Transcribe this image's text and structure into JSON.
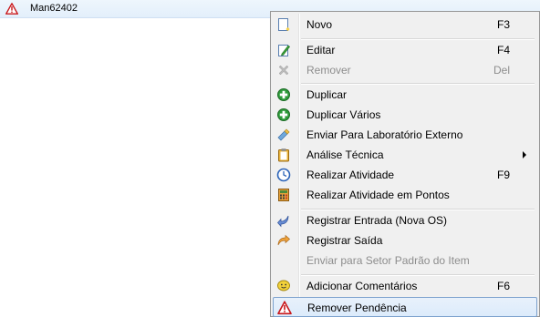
{
  "list": {
    "row_label": "Man62402"
  },
  "menu": {
    "items": {
      "novo": {
        "label": "Novo",
        "shortcut": "F3"
      },
      "editar": {
        "label": "Editar",
        "shortcut": "F4"
      },
      "remover": {
        "label": "Remover",
        "shortcut": "Del"
      },
      "duplicar": {
        "label": "Duplicar"
      },
      "duplicar_varios": {
        "label": "Duplicar Vários"
      },
      "enviar_lab": {
        "label": "Enviar Para Laboratório Externo"
      },
      "analise_tecnica": {
        "label": "Análise Técnica"
      },
      "realizar_atividade": {
        "label": "Realizar Atividade",
        "shortcut": "F9"
      },
      "realizar_pontos": {
        "label": "Realizar Atividade em Pontos"
      },
      "registrar_entrada": {
        "label": "Registrar Entrada (Nova OS)"
      },
      "registrar_saida": {
        "label": "Registrar Saída"
      },
      "enviar_setor": {
        "label": "Enviar para Setor Padrão do Item"
      },
      "adicionar_comentarios": {
        "label": "Adicionar Comentários",
        "shortcut": "F6"
      },
      "remover_pendencia": {
        "label": "Remover Pendência"
      }
    }
  },
  "icons": {
    "row": "warning-icon",
    "novo": "new-document-icon",
    "editar": "edit-pencil-icon",
    "remover": "delete-x-icon",
    "duplicar": "green-plus-icon",
    "duplicar_varios": "green-plus-icon",
    "enviar_lab": "lab-send-icon",
    "analise_tecnica": "clipboard-icon",
    "realizar_atividade": "clock-icon",
    "realizar_pontos": "calculator-icon",
    "registrar_entrada": "arrow-return-icon",
    "registrar_saida": "arrow-forward-icon",
    "adicionar_comentarios": "comment-smiley-icon",
    "remover_pendencia": "warning-icon"
  },
  "colors": {
    "menu_bg": "#f0f0f0",
    "selection_border": "#7da2ce",
    "disabled_text": "#8d8d8d",
    "warning_red": "#d21f1f"
  }
}
